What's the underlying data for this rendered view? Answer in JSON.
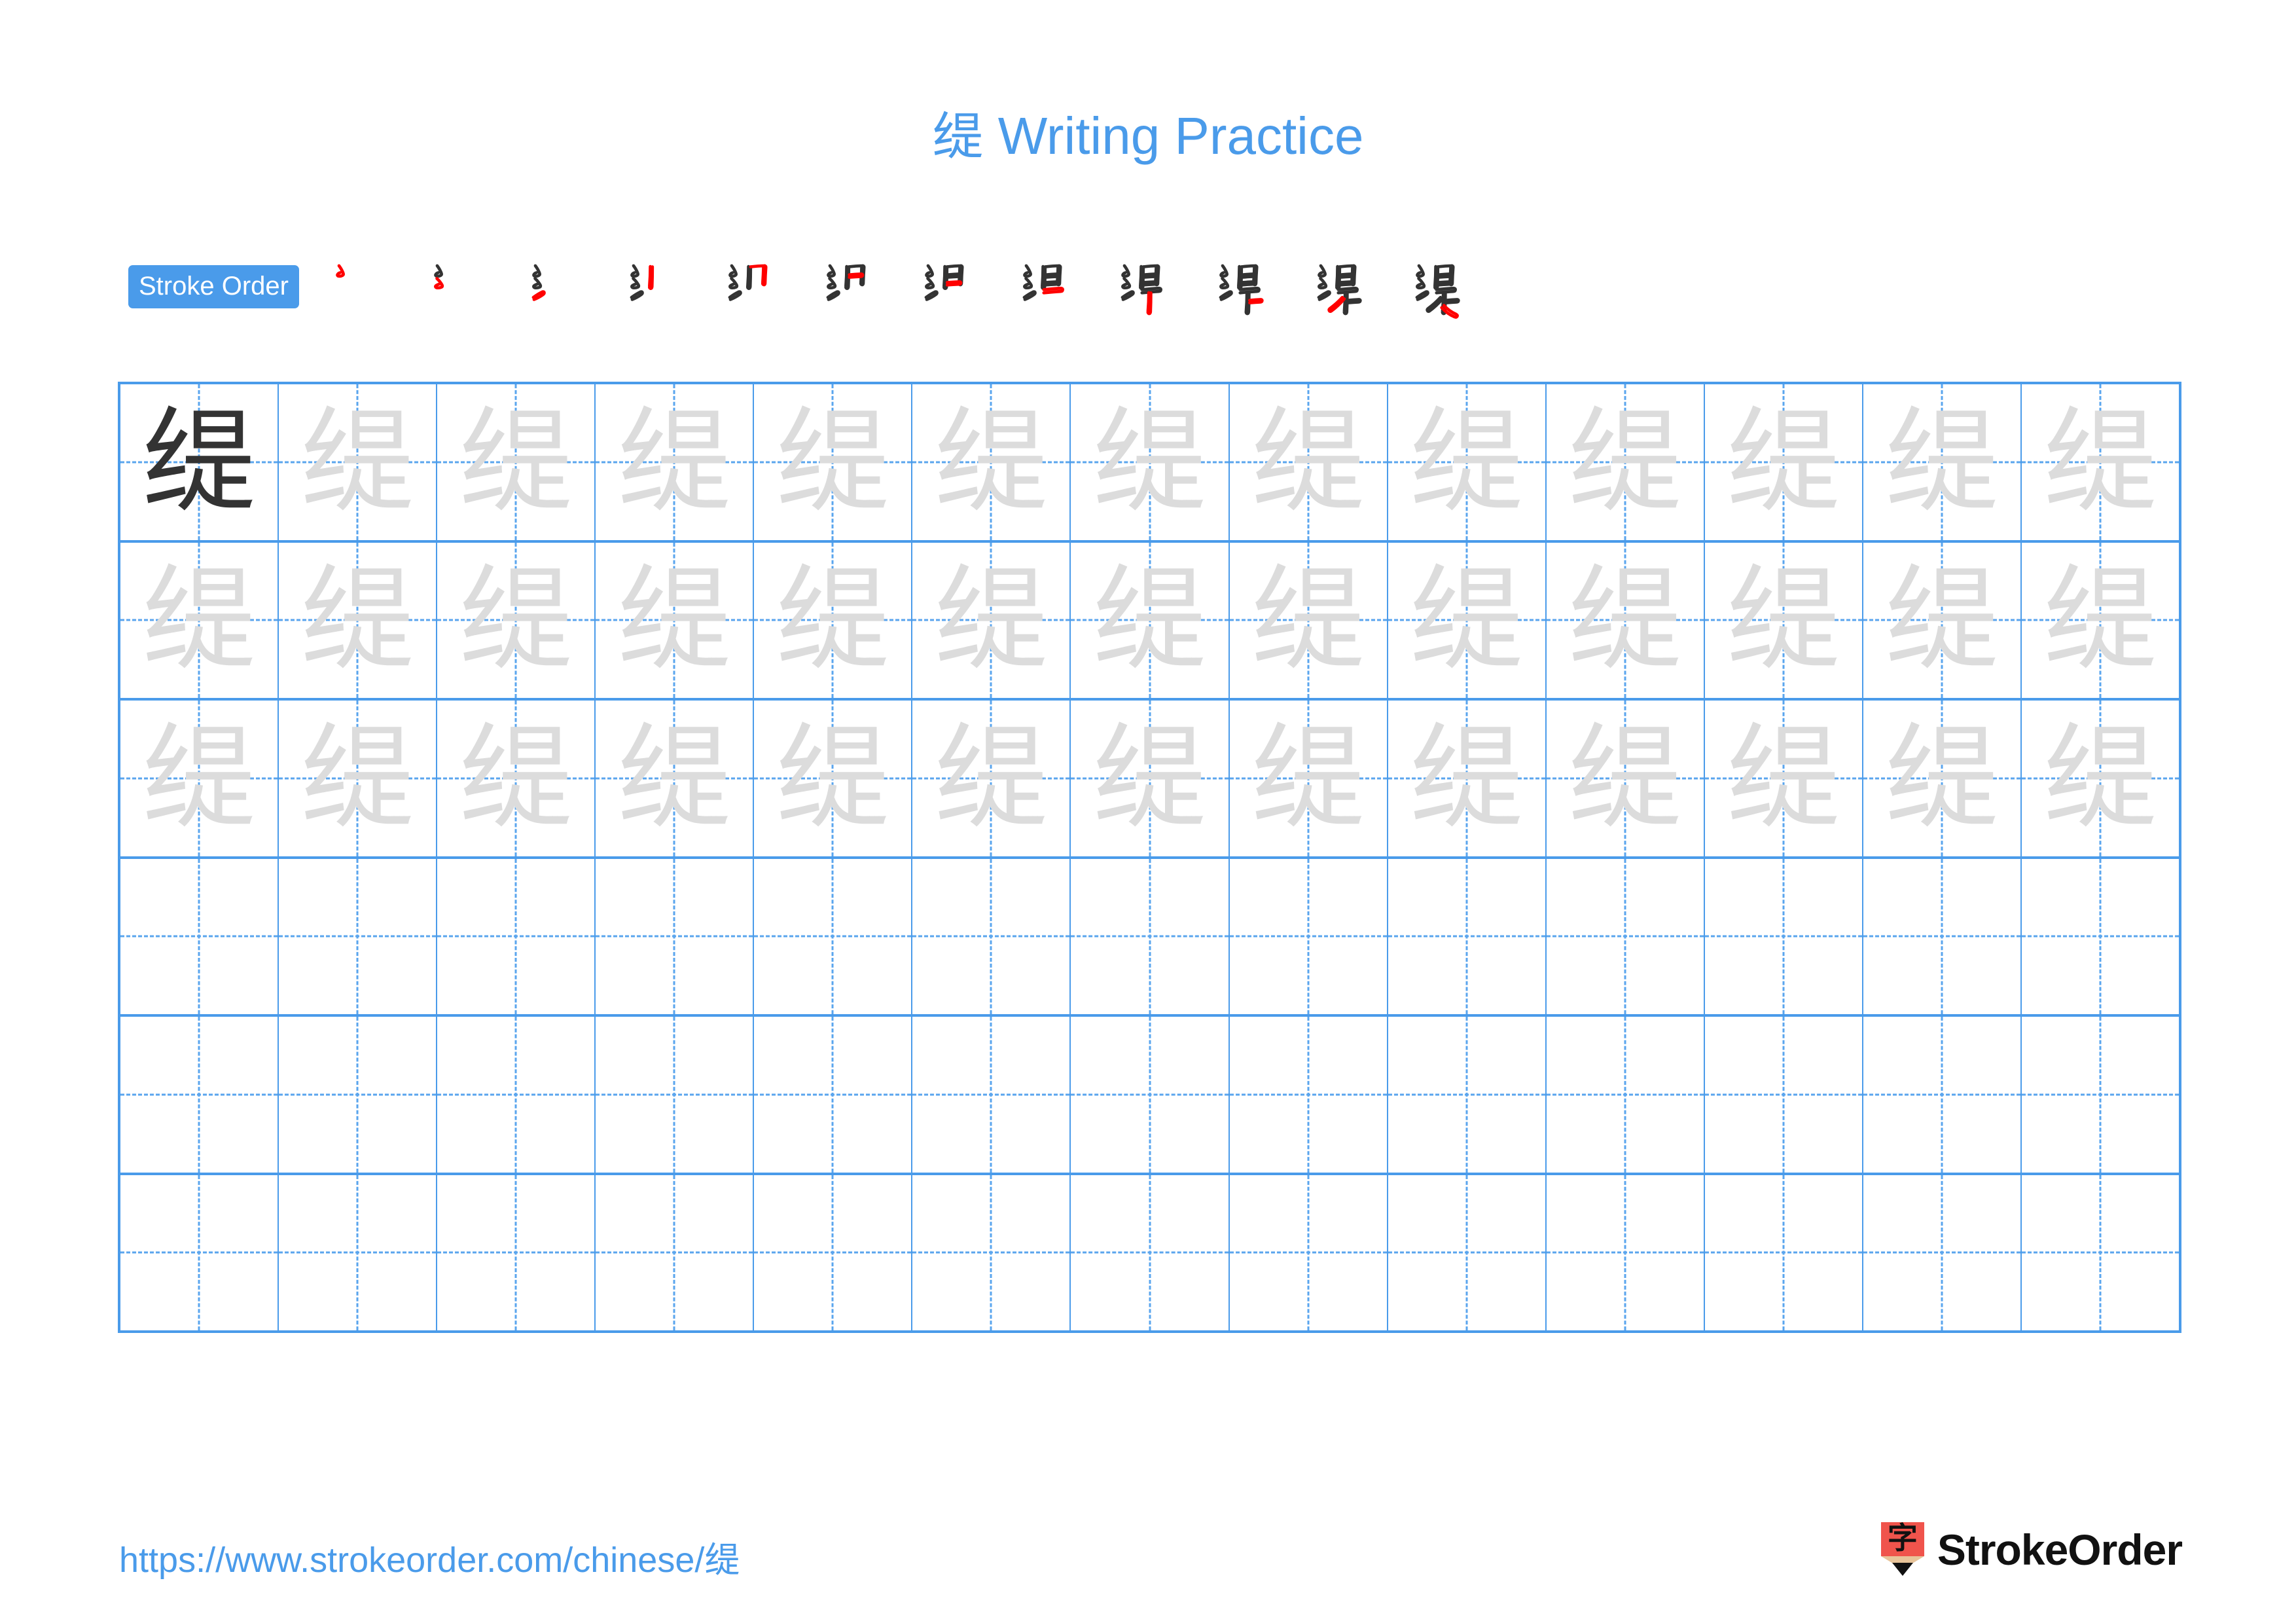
{
  "character": "缇",
  "header": {
    "title_char": "缇",
    "title_suffix": " Writing Practice",
    "title_color": "#4A9BEA"
  },
  "stroke_order": {
    "badge_label": "Stroke Order",
    "badge_bg": "#4A9BEA",
    "badge_text_color": "#FFFFFF",
    "stroke_count": 12,
    "new_stroke_color": "#FF0000",
    "done_stroke_color": "#333333",
    "steps": [
      {
        "index": 1,
        "strokes_shown": 1,
        "new_stroke": "撇折"
      },
      {
        "index": 2,
        "strokes_shown": 2,
        "new_stroke": "撇折"
      },
      {
        "index": 3,
        "strokes_shown": 3,
        "new_stroke": "提"
      },
      {
        "index": 4,
        "strokes_shown": 4,
        "new_stroke": "竖"
      },
      {
        "index": 5,
        "strokes_shown": 5,
        "new_stroke": "横折"
      },
      {
        "index": 6,
        "strokes_shown": 6,
        "new_stroke": "横"
      },
      {
        "index": 7,
        "strokes_shown": 7,
        "new_stroke": "横"
      },
      {
        "index": 8,
        "strokes_shown": 8,
        "new_stroke": "横"
      },
      {
        "index": 9,
        "strokes_shown": 9,
        "new_stroke": "竖"
      },
      {
        "index": 10,
        "strokes_shown": 10,
        "new_stroke": "横"
      },
      {
        "index": 11,
        "strokes_shown": 11,
        "new_stroke": "撇"
      },
      {
        "index": 12,
        "strokes_shown": 12,
        "new_stroke": "捺"
      }
    ]
  },
  "practice_grid": {
    "columns": 13,
    "rows": 6,
    "border_color": "#4A9BEA",
    "guide_color": "#5AA5EE",
    "model_char_color": "#333333",
    "trace_char_color": "#DCDCDC",
    "cells": [
      [
        "model",
        "trace",
        "trace",
        "trace",
        "trace",
        "trace",
        "trace",
        "trace",
        "trace",
        "trace",
        "trace",
        "trace",
        "trace"
      ],
      [
        "trace",
        "trace",
        "trace",
        "trace",
        "trace",
        "trace",
        "trace",
        "trace",
        "trace",
        "trace",
        "trace",
        "trace",
        "trace"
      ],
      [
        "trace",
        "trace",
        "trace",
        "trace",
        "trace",
        "trace",
        "trace",
        "trace",
        "trace",
        "trace",
        "trace",
        "trace",
        "trace"
      ],
      [
        "blank",
        "blank",
        "blank",
        "blank",
        "blank",
        "blank",
        "blank",
        "blank",
        "blank",
        "blank",
        "blank",
        "blank",
        "blank"
      ],
      [
        "blank",
        "blank",
        "blank",
        "blank",
        "blank",
        "blank",
        "blank",
        "blank",
        "blank",
        "blank",
        "blank",
        "blank",
        "blank"
      ],
      [
        "blank",
        "blank",
        "blank",
        "blank",
        "blank",
        "blank",
        "blank",
        "blank",
        "blank",
        "blank",
        "blank",
        "blank",
        "blank"
      ]
    ]
  },
  "footer": {
    "url_prefix": "https://www.strokeorder.com/chinese/",
    "url_char": "缇",
    "url_color": "#4A9BEA",
    "brand_name": "StrokeOrder",
    "brand_icon_glyph": "字",
    "brand_icon_color": "#F0544C",
    "brand_icon_wood_color": "#E8C49A",
    "brand_icon_tip_color": "#111111"
  }
}
